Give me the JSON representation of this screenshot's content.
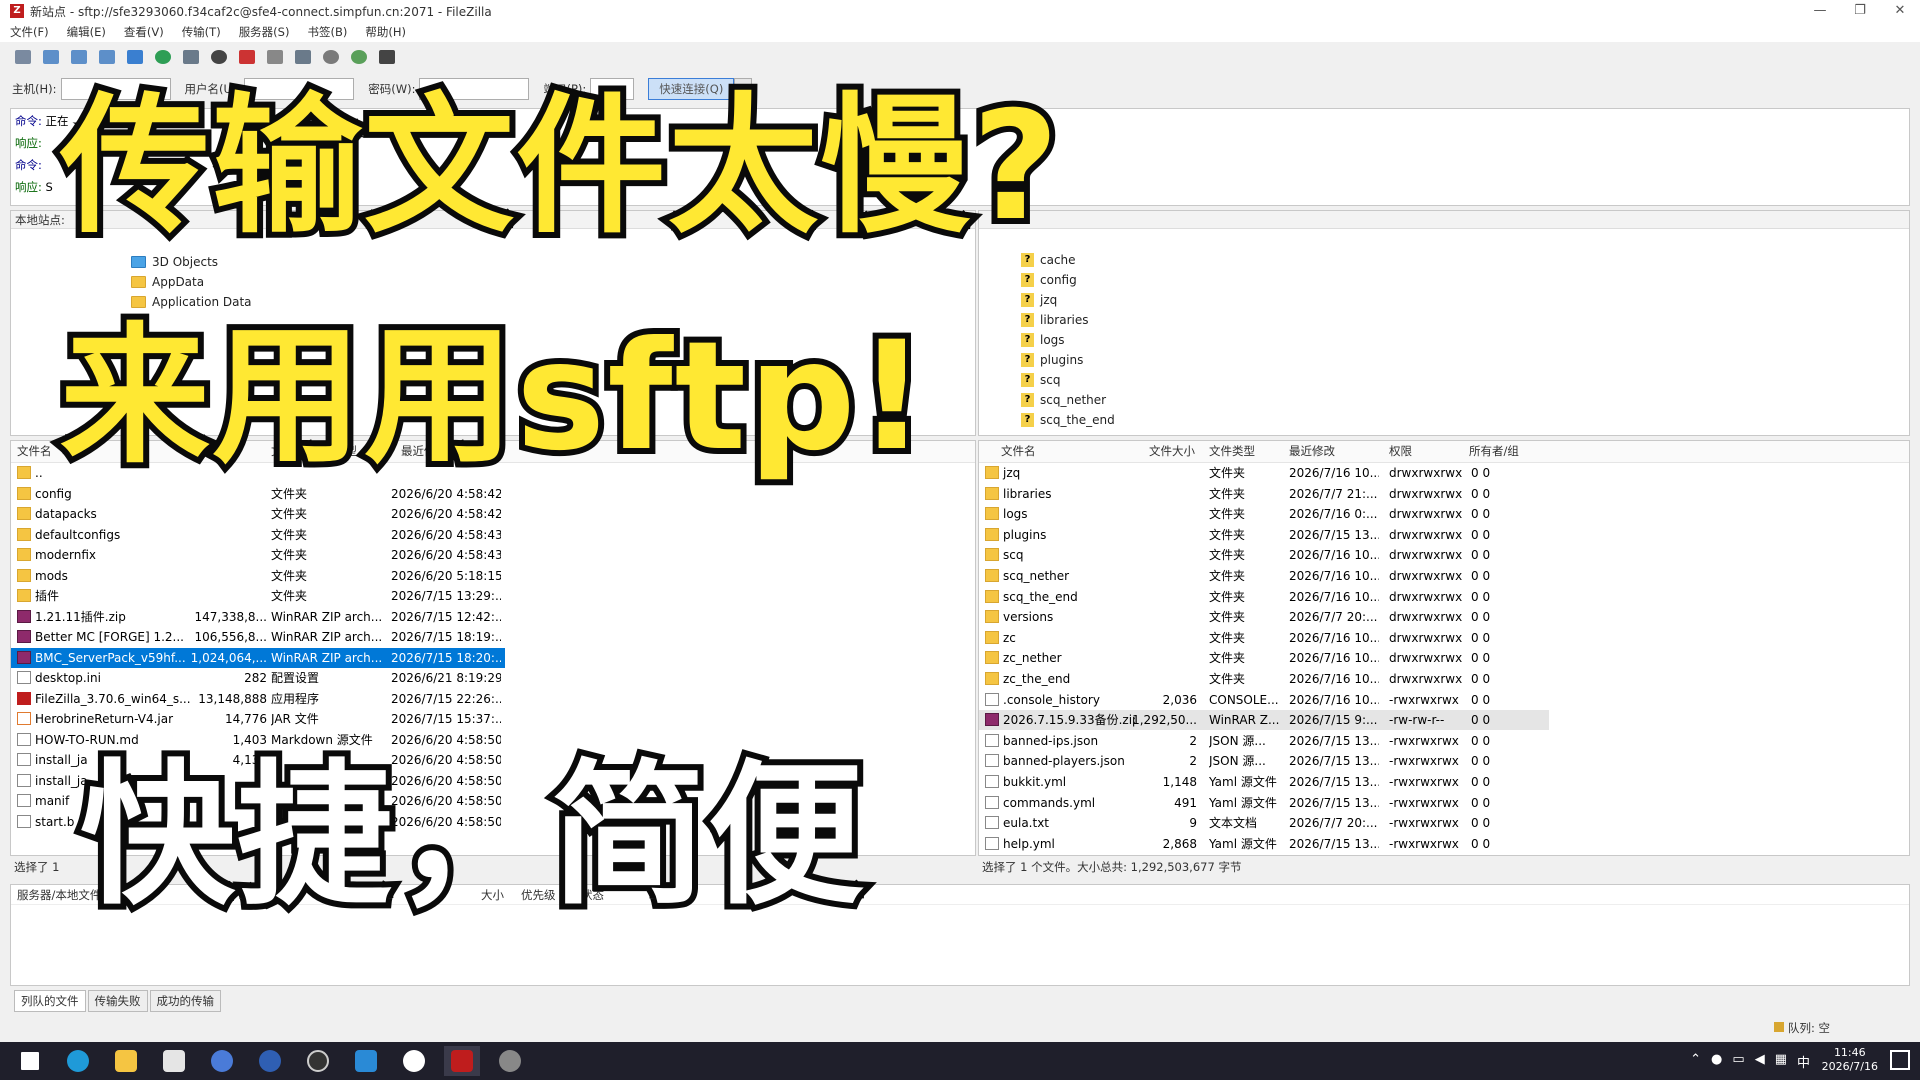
{
  "window": {
    "title": "新站点 - sftp://sfe3293060.f34caf2c@sfe4-connect.simpfun.cn:2071 - FileZilla",
    "icon": "filezilla-icon"
  },
  "menu": [
    "文件(F)",
    "编辑(E)",
    "查看(V)",
    "传输(T)",
    "服务器(S)",
    "书签(B)",
    "帮助(H)"
  ],
  "quickconnect": {
    "host_label": "主机(H):",
    "user_label": "用户名(U):",
    "pass_label": "密码(W):",
    "port_label": "端口(P):",
    "button": "快速连接(Q)"
  },
  "log": [
    {
      "prefix": "命令:",
      "text": "正在"
    },
    {
      "prefix": "响应:",
      "text": ""
    },
    {
      "prefix": "命令:",
      "text": ""
    },
    {
      "prefix": "响应:",
      "text": "S"
    }
  ],
  "local": {
    "header": "本地站点:",
    "tree": [
      "3D Objects",
      "AppData",
      "Application Data"
    ],
    "columns": [
      "文件名",
      "文件大小",
      "文件类型",
      "最近修改"
    ],
    "files": [
      {
        "name": "..",
        "size": "",
        "type": "",
        "date": "",
        "icon": "folder"
      },
      {
        "name": "config",
        "size": "",
        "type": "文件夹",
        "date": "2026/6/20 4:58:42",
        "icon": "folder"
      },
      {
        "name": "datapacks",
        "size": "",
        "type": "文件夹",
        "date": "2026/6/20 4:58:42",
        "icon": "folder"
      },
      {
        "name": "defaultconfigs",
        "size": "",
        "type": "文件夹",
        "date": "2026/6/20 4:58:43",
        "icon": "folder"
      },
      {
        "name": "modernfix",
        "size": "",
        "type": "文件夹",
        "date": "2026/6/20 4:58:43",
        "icon": "folder"
      },
      {
        "name": "mods",
        "size": "",
        "type": "文件夹",
        "date": "2026/6/20 5:18:15",
        "icon": "folder"
      },
      {
        "name": "插件",
        "size": "",
        "type": "文件夹",
        "date": "2026/7/15 13:29:...",
        "icon": "folder"
      },
      {
        "name": "1.21.11插件.zip",
        "size": "147,338,8...",
        "type": "WinRAR ZIP arch...",
        "date": "2026/7/15 12:42:...",
        "icon": "zip"
      },
      {
        "name": "Better MC [FORGE] 1.2...",
        "size": "106,556,8...",
        "type": "WinRAR ZIP arch...",
        "date": "2026/7/15 18:19:...",
        "icon": "zip"
      },
      {
        "name": "BMC_ServerPack_v59hf...",
        "size": "1,024,064,...",
        "type": "WinRAR ZIP arch...",
        "date": "2026/7/15 18:20:...",
        "icon": "zip",
        "selected": true
      },
      {
        "name": "desktop.ini",
        "size": "282",
        "type": "配置设置",
        "date": "2026/6/21 8:19:29",
        "icon": "doc"
      },
      {
        "name": "FileZilla_3.70.6_win64_s...",
        "size": "13,148,888",
        "type": "应用程序",
        "date": "2026/7/15 22:26:...",
        "icon": "exe"
      },
      {
        "name": "HerobrineReturn-V4.jar",
        "size": "14,776",
        "type": "JAR 文件",
        "date": "2026/7/15 15:37:...",
        "icon": "jar"
      },
      {
        "name": "HOW-TO-RUN.md",
        "size": "1,403",
        "type": "Markdown 源文件",
        "date": "2026/6/20 4:58:50",
        "icon": "doc"
      },
      {
        "name": "install_ja",
        "size": "4,131",
        "type": "",
        "date": "2026/6/20 4:58:50",
        "icon": "doc"
      },
      {
        "name": "install_ja",
        "size": "",
        "type": "",
        "date": "2026/6/20 4:58:50",
        "icon": "doc"
      },
      {
        "name": "manif",
        "size": "",
        "type": "",
        "date": "2026/6/20 4:58:50",
        "icon": "doc"
      },
      {
        "name": "start.b",
        "size": "",
        "type": "",
        "date": "2026/6/20 4:58:50",
        "icon": "doc"
      }
    ],
    "status": "选择了 1"
  },
  "remote": {
    "tree": [
      "cache",
      "config",
      "jzq",
      "libraries",
      "logs",
      "plugins",
      "scq",
      "scq_nether",
      "scq_the_end"
    ],
    "columns": [
      "文件名",
      "文件大小",
      "文件类型",
      "最近修改",
      "权限",
      "所有者/组"
    ],
    "files": [
      {
        "name": "jzq",
        "size": "",
        "type": "文件夹",
        "date": "2026/7/16 10...",
        "perm": "drwxrwxrwx",
        "owner": "0 0",
        "icon": "folder"
      },
      {
        "name": "libraries",
        "size": "",
        "type": "文件夹",
        "date": "2026/7/7 21:...",
        "perm": "drwxrwxrwx",
        "owner": "0 0",
        "icon": "folder"
      },
      {
        "name": "logs",
        "size": "",
        "type": "文件夹",
        "date": "2026/7/16 0:...",
        "perm": "drwxrwxrwx",
        "owner": "0 0",
        "icon": "folder"
      },
      {
        "name": "plugins",
        "size": "",
        "type": "文件夹",
        "date": "2026/7/15 13...",
        "perm": "drwxrwxrwx",
        "owner": "0 0",
        "icon": "folder"
      },
      {
        "name": "scq",
        "size": "",
        "type": "文件夹",
        "date": "2026/7/16 10...",
        "perm": "drwxrwxrwx",
        "owner": "0 0",
        "icon": "folder"
      },
      {
        "name": "scq_nether",
        "size": "",
        "type": "文件夹",
        "date": "2026/7/16 10...",
        "perm": "drwxrwxrwx",
        "owner": "0 0",
        "icon": "folder"
      },
      {
        "name": "scq_the_end",
        "size": "",
        "type": "文件夹",
        "date": "2026/7/16 10...",
        "perm": "drwxrwxrwx",
        "owner": "0 0",
        "icon": "folder"
      },
      {
        "name": "versions",
        "size": "",
        "type": "文件夹",
        "date": "2026/7/7 20:...",
        "perm": "drwxrwxrwx",
        "owner": "0 0",
        "icon": "folder"
      },
      {
        "name": "zc",
        "size": "",
        "type": "文件夹",
        "date": "2026/7/16 10...",
        "perm": "drwxrwxrwx",
        "owner": "0 0",
        "icon": "folder"
      },
      {
        "name": "zc_nether",
        "size": "",
        "type": "文件夹",
        "date": "2026/7/16 10...",
        "perm": "drwxrwxrwx",
        "owner": "0 0",
        "icon": "folder"
      },
      {
        "name": "zc_the_end",
        "size": "",
        "type": "文件夹",
        "date": "2026/7/16 10...",
        "perm": "drwxrwxrwx",
        "owner": "0 0",
        "icon": "folder"
      },
      {
        "name": ".console_history",
        "size": "2,036",
        "type": "CONSOLE...",
        "date": "2026/7/16 10...",
        "perm": "-rwxrwxrwx",
        "owner": "0 0",
        "icon": "doc"
      },
      {
        "name": "2026.7.15.9.33备份.zip",
        "size": "1,292,50...",
        "type": "WinRAR Z...",
        "date": "2026/7/15 9:...",
        "perm": "-rw-rw-r--",
        "owner": "0 0",
        "icon": "zip",
        "highlight": true
      },
      {
        "name": "banned-ips.json",
        "size": "2",
        "type": "JSON 源...",
        "date": "2026/7/15 13...",
        "perm": "-rwxrwxrwx",
        "owner": "0 0",
        "icon": "doc"
      },
      {
        "name": "banned-players.json",
        "size": "2",
        "type": "JSON 源...",
        "date": "2026/7/15 13...",
        "perm": "-rwxrwxrwx",
        "owner": "0 0",
        "icon": "doc"
      },
      {
        "name": "bukkit.yml",
        "size": "1,148",
        "type": "Yaml 源文件",
        "date": "2026/7/15 13...",
        "perm": "-rwxrwxrwx",
        "owner": "0 0",
        "icon": "doc"
      },
      {
        "name": "commands.yml",
        "size": "491",
        "type": "Yaml 源文件",
        "date": "2026/7/15 13...",
        "perm": "-rwxrwxrwx",
        "owner": "0 0",
        "icon": "doc"
      },
      {
        "name": "eula.txt",
        "size": "9",
        "type": "文本文档",
        "date": "2026/7/7 20:...",
        "perm": "-rwxrwxrwx",
        "owner": "0 0",
        "icon": "doc"
      },
      {
        "name": "help.yml",
        "size": "2,868",
        "type": "Yaml 源文件",
        "date": "2026/7/15 13...",
        "perm": "-rwxrwxrwx",
        "owner": "0 0",
        "icon": "doc"
      }
    ],
    "status": "选择了 1 个文件。大小总共: 1,292,503,677 字节"
  },
  "queue": {
    "columns": [
      "服务器/本地文件",
      "大小",
      "优先级",
      "状态"
    ],
    "tabs": [
      "列队的文件",
      "传输失败",
      "成功的传输"
    ],
    "status": "队列: 空"
  },
  "taskbar": {
    "time": "11:46",
    "date": "2026/7/16",
    "ime": "中"
  },
  "overlay": {
    "line1": "传输文件太慢?",
    "line2": "来用用sftp!",
    "line3": "快捷，简便"
  },
  "colors": {
    "overlay_yellow": "#ffe833",
    "overlay_white": "#ffffff",
    "selection": "#0078d7"
  }
}
